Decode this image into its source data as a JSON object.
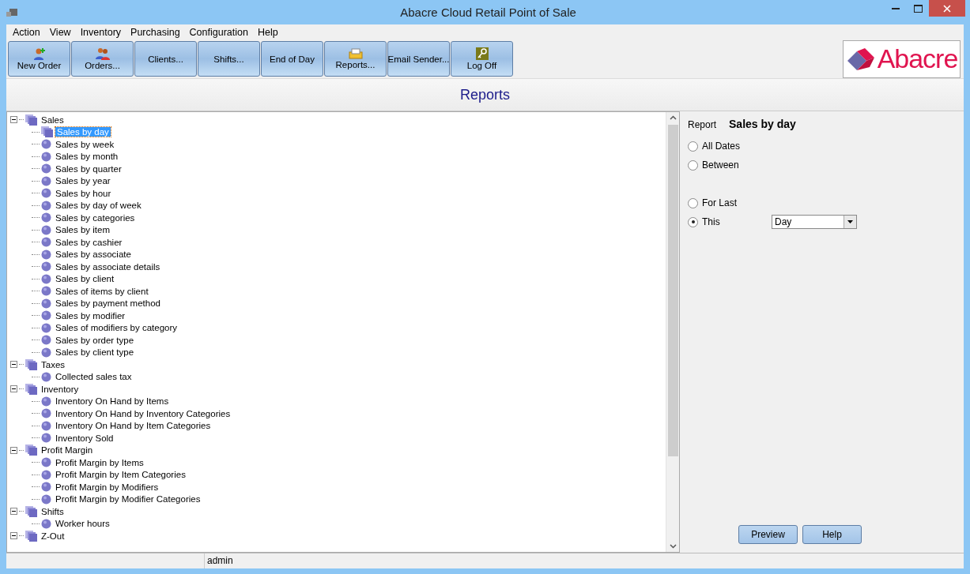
{
  "window": {
    "title": "Abacre Cloud Retail Point of Sale"
  },
  "menu": [
    "Action",
    "View",
    "Inventory",
    "Purchasing",
    "Configuration",
    "Help"
  ],
  "toolbar": [
    {
      "label": "New Order",
      "kind": "add-person"
    },
    {
      "label": "Orders...",
      "kind": "people"
    },
    {
      "label": "Clients...",
      "kind": "plain"
    },
    {
      "label": "Shifts...",
      "kind": "plain"
    },
    {
      "label": "End of Day",
      "kind": "plain"
    },
    {
      "label": "Reports...",
      "kind": "reports"
    },
    {
      "label": "Email Sender...",
      "kind": "plain"
    },
    {
      "label": "Log Off",
      "kind": "key"
    }
  ],
  "logo": {
    "text": "Abacre"
  },
  "heading": "Reports",
  "tree": [
    {
      "label": "Sales",
      "expanded": true,
      "children": [
        {
          "label": "Sales by day",
          "selected": true
        },
        {
          "label": "Sales by week",
          "selected": false
        },
        {
          "label": "Sales by month",
          "selected": false
        },
        {
          "label": "Sales by quarter",
          "selected": false
        },
        {
          "label": "Sales by year",
          "selected": false
        },
        {
          "label": "Sales by hour",
          "selected": false
        },
        {
          "label": "Sales by day of week",
          "selected": false
        },
        {
          "label": "Sales by categories",
          "selected": false
        },
        {
          "label": "Sales by item",
          "selected": false
        },
        {
          "label": "Sales by cashier",
          "selected": false
        },
        {
          "label": "Sales by associate",
          "selected": false
        },
        {
          "label": "Sales by associate details",
          "selected": false
        },
        {
          "label": "Sales by client",
          "selected": false
        },
        {
          "label": "Sales of items by client",
          "selected": false
        },
        {
          "label": "Sales by payment method",
          "selected": false
        },
        {
          "label": "Sales by modifier",
          "selected": false
        },
        {
          "label": "Sales of modifiers by category",
          "selected": false
        },
        {
          "label": "Sales by order type",
          "selected": false
        },
        {
          "label": "Sales by client type",
          "selected": false
        }
      ]
    },
    {
      "label": "Taxes",
      "expanded": true,
      "children": [
        {
          "label": "Collected sales tax",
          "selected": false
        }
      ]
    },
    {
      "label": "Inventory",
      "expanded": true,
      "children": [
        {
          "label": "Inventory On Hand by Items",
          "selected": false
        },
        {
          "label": "Inventory On Hand by Inventory Categories",
          "selected": false
        },
        {
          "label": "Inventory On Hand by Item Categories",
          "selected": false
        },
        {
          "label": "Inventory Sold",
          "selected": false
        }
      ]
    },
    {
      "label": "Profit Margin",
      "expanded": true,
      "children": [
        {
          "label": "Profit Margin by Items",
          "selected": false
        },
        {
          "label": "Profit Margin by Item Categories",
          "selected": false
        },
        {
          "label": "Profit Margin by Modifiers",
          "selected": false
        },
        {
          "label": "Profit Margin by Modifier Categories",
          "selected": false
        }
      ]
    },
    {
      "label": "Shifts",
      "expanded": true,
      "children": [
        {
          "label": "Worker hours",
          "selected": false
        }
      ]
    },
    {
      "label": "Z-Out",
      "expanded": true
    }
  ],
  "report": {
    "label": "Report",
    "name": "Sales by day"
  },
  "range_options": [
    {
      "label": "All Dates",
      "selected": false
    },
    {
      "label": "Between",
      "selected": false
    },
    {
      "label": "For Last",
      "selected": false
    },
    {
      "label": "This",
      "selected": true
    }
  ],
  "period": {
    "value": "Day"
  },
  "buttons": [
    "Preview",
    "Help"
  ],
  "status_bar": {
    "user": "admin"
  }
}
